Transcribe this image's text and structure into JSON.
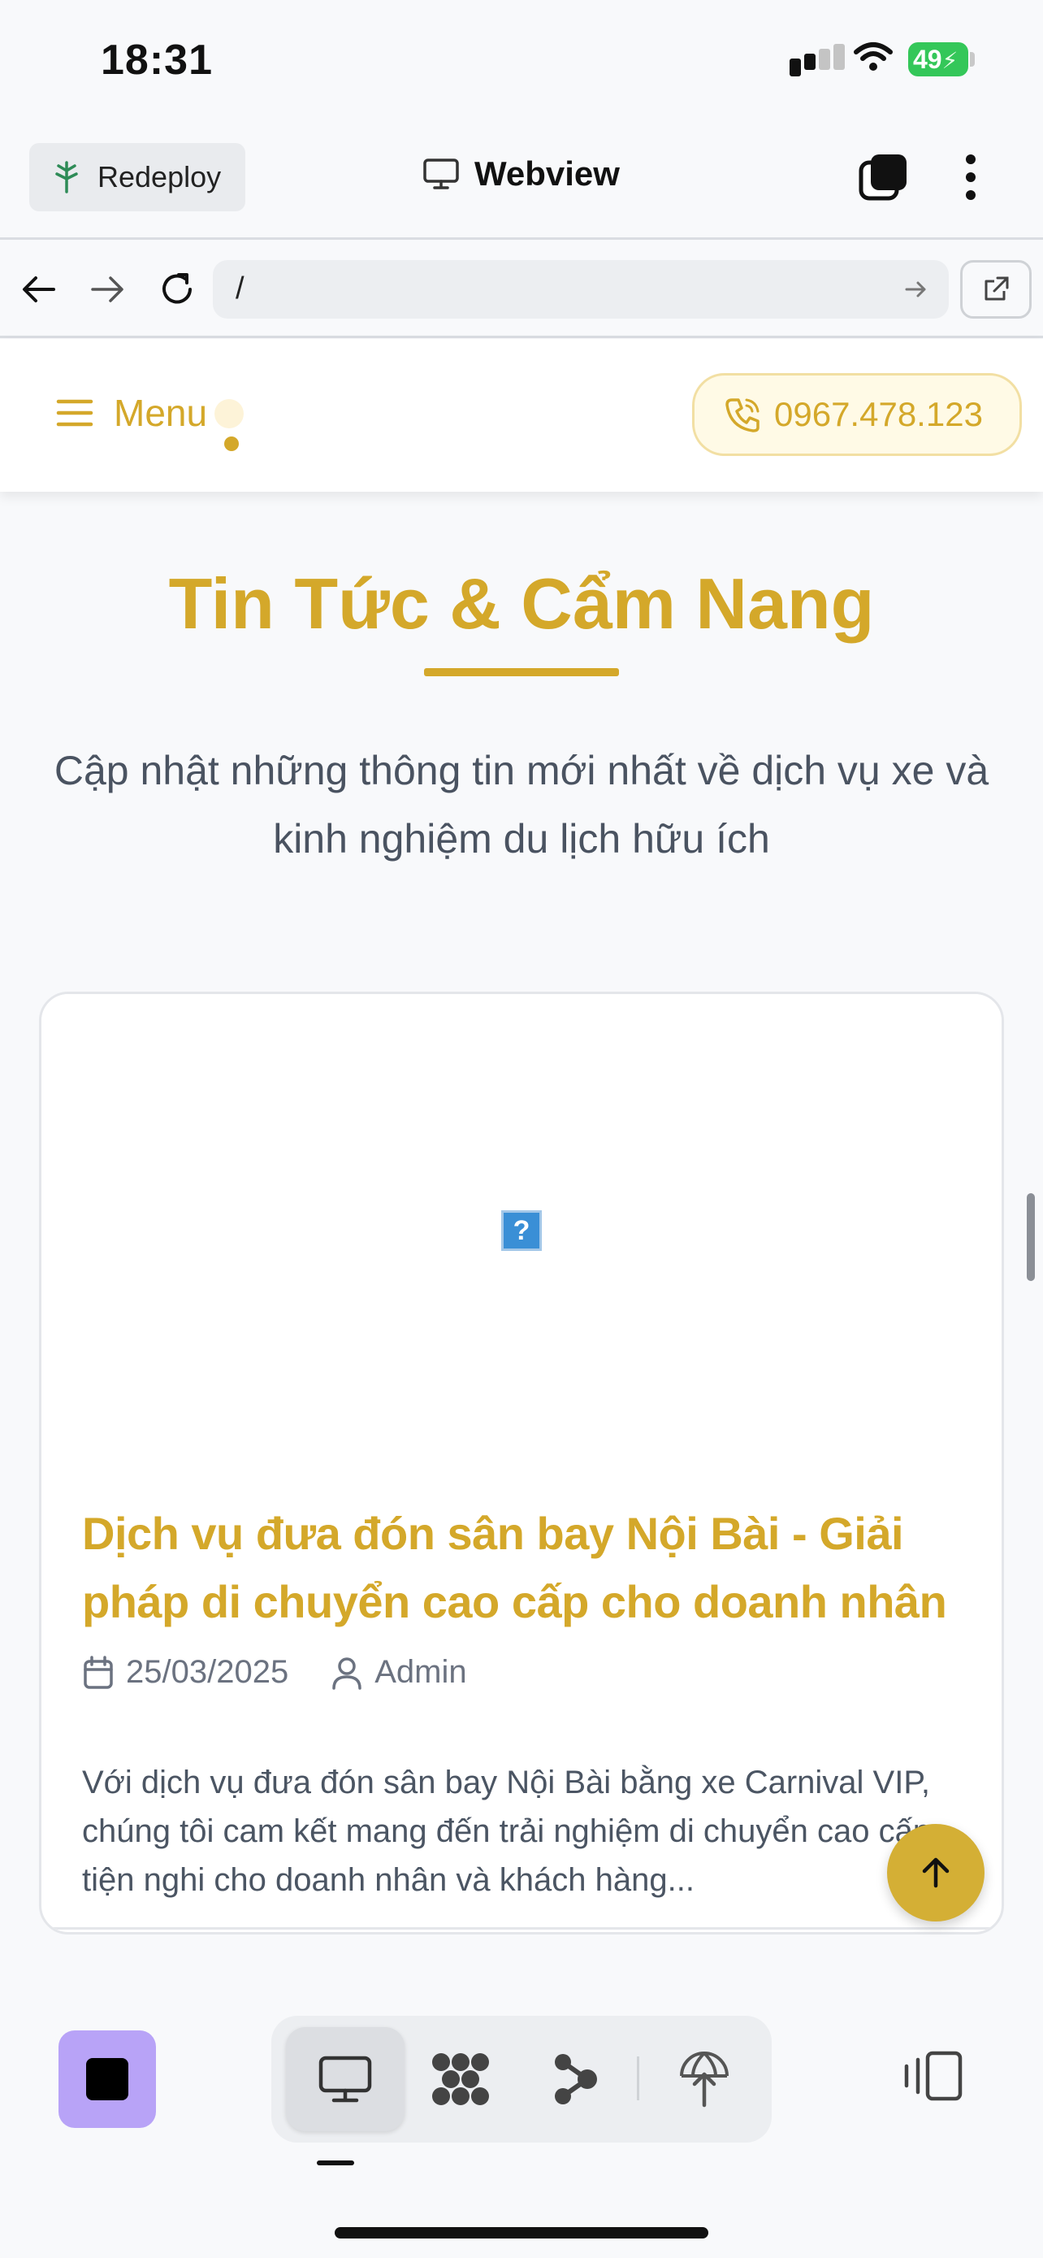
{
  "status_bar": {
    "time": "18:31",
    "battery": "49"
  },
  "app_header": {
    "redeploy_label": "Redeploy",
    "title": "Webview"
  },
  "url_bar": {
    "url": "/"
  },
  "site_nav": {
    "menu_label": "Menu",
    "phone": "0967.478.123"
  },
  "section": {
    "title": "Tin Tức & Cẩm Nang",
    "description": "Cập nhật những thông tin mới nhất về dịch vụ xe và kinh nghiệm du lịch hữu ích"
  },
  "article": {
    "image_placeholder": "?",
    "title": "Dịch vụ đưa đón sân bay Nội Bài - Giải pháp di chuyển cao cấp cho doanh nhân",
    "date": "25/03/2025",
    "author": "Admin",
    "excerpt": "Với dịch vụ đưa đón sân bay Nội Bài bằng xe Carnival VIP, chúng tôi cam kết mang đến trải nghiệm di chuyển cao cấp, tiện nghi cho doanh nhân và khách hàng..."
  },
  "colors": {
    "accent": "#d4a82a",
    "stop_button": "#b8a3f7",
    "battery": "#34c759"
  },
  "icons": {
    "status": [
      "cellular-signal-icon",
      "wifi-icon",
      "battery-icon"
    ],
    "header": [
      "tree-icon",
      "monitor-icon",
      "tabs-icon",
      "more-vertical-icon"
    ],
    "toolbar": [
      "monitor-icon",
      "grid-icon",
      "flow-icon",
      "network-icon",
      "layout-icon"
    ]
  }
}
